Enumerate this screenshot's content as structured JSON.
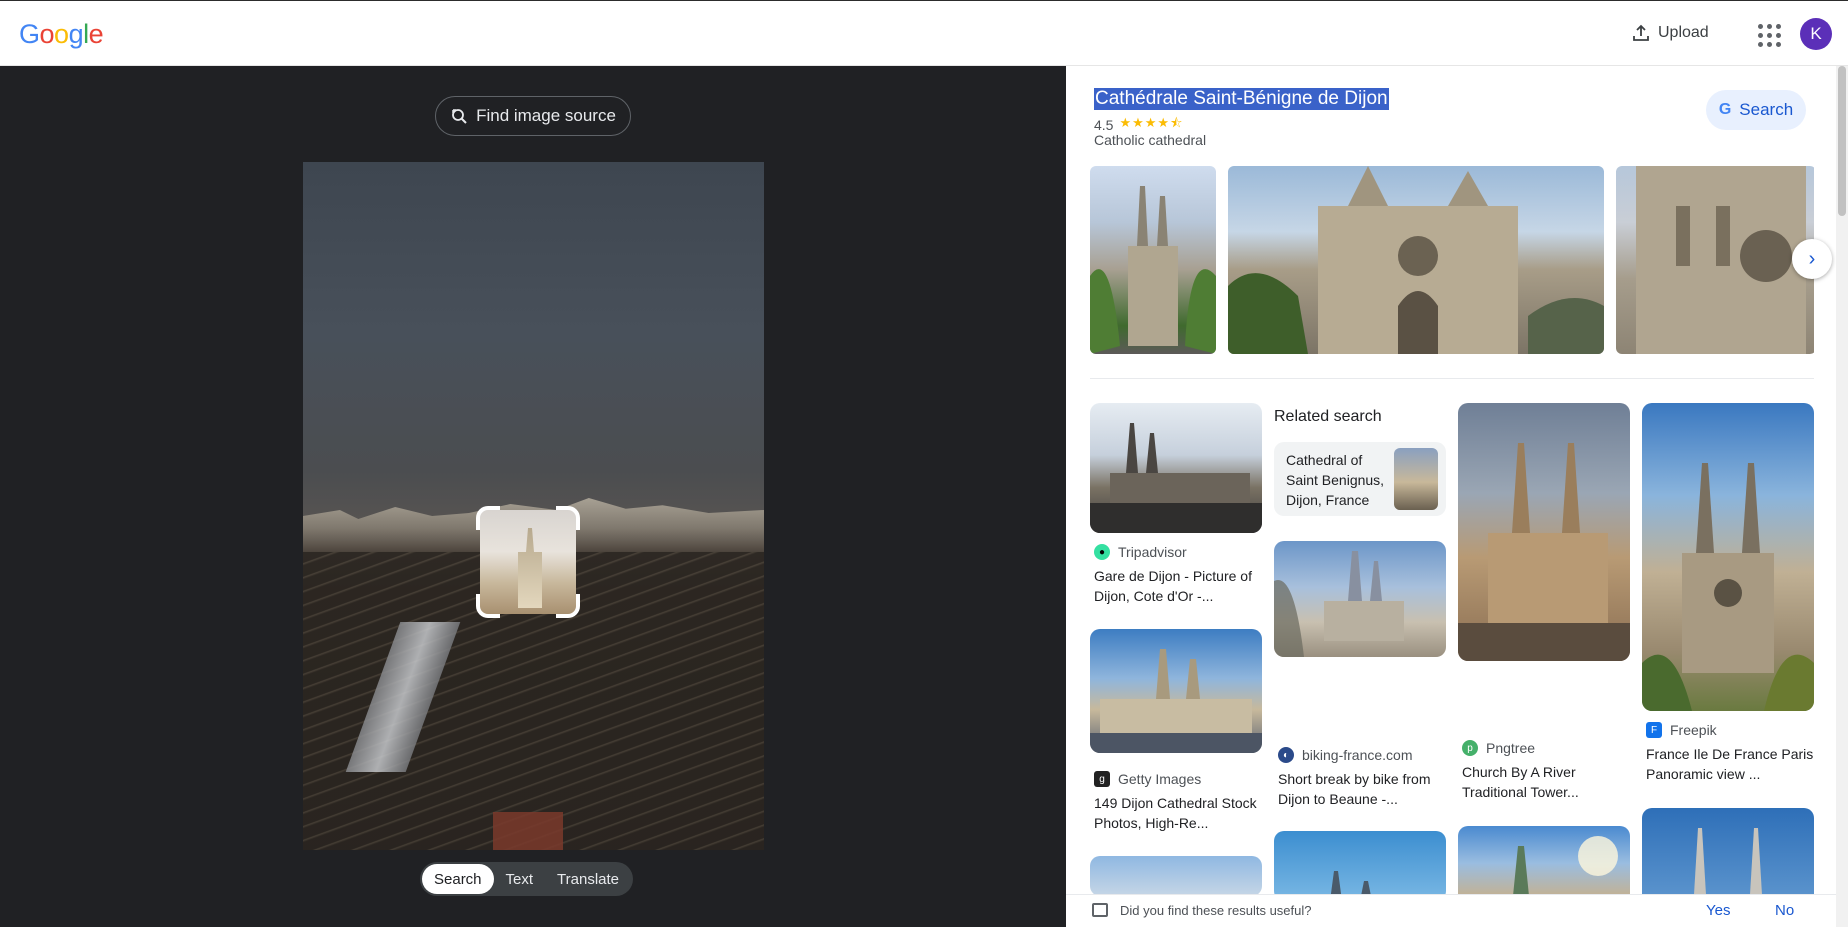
{
  "app": {
    "logo": [
      "G",
      "o",
      "o",
      "g",
      "l",
      "e"
    ],
    "logo_colors": [
      "#4285F4",
      "#EA4335",
      "#FBBC05",
      "#4285F4",
      "#34A853",
      "#EA4335"
    ],
    "upload_label": "Upload",
    "avatar_letter": "K",
    "avatar_color": "#5b2fb8"
  },
  "viewer": {
    "find_source_label": "Find image source",
    "modes": [
      "Search",
      "Text",
      "Translate"
    ],
    "active_mode": "Search"
  },
  "knowledge": {
    "title": "Cathédrale Saint-Bénigne de Dijon",
    "rating": "4.5",
    "stars": "★★★★⯪",
    "type": "Catholic cathedral",
    "search_label": "Search"
  },
  "results": {
    "related_heading": "Related search",
    "related_items": [
      {
        "label": "Cathedral of Saint Benignus, Dijon, France"
      }
    ],
    "cards": [
      {
        "source": "Tripadvisor",
        "title": "Gare de Dijon - Picture of Dijon, Cote d'Or -..."
      },
      {
        "source": "Getty Images",
        "title": "149 Dijon Cathedral Stock Photos, High-Re..."
      },
      {
        "source": "biking-france.com",
        "title": "Short break by bike from Dijon to Beaune -..."
      },
      {
        "source": "Pngtree",
        "title": "Church By A River Traditional Tower..."
      },
      {
        "source": "Freepik",
        "title": "France Ile De France Paris Panoramic view ..."
      }
    ]
  },
  "feedback": {
    "question": "Did you find these results useful?",
    "yes": "Yes",
    "no": "No"
  },
  "colors": {
    "accent": "#1a58d0",
    "dark_bg": "#202124",
    "selection": "#3a62c9"
  }
}
